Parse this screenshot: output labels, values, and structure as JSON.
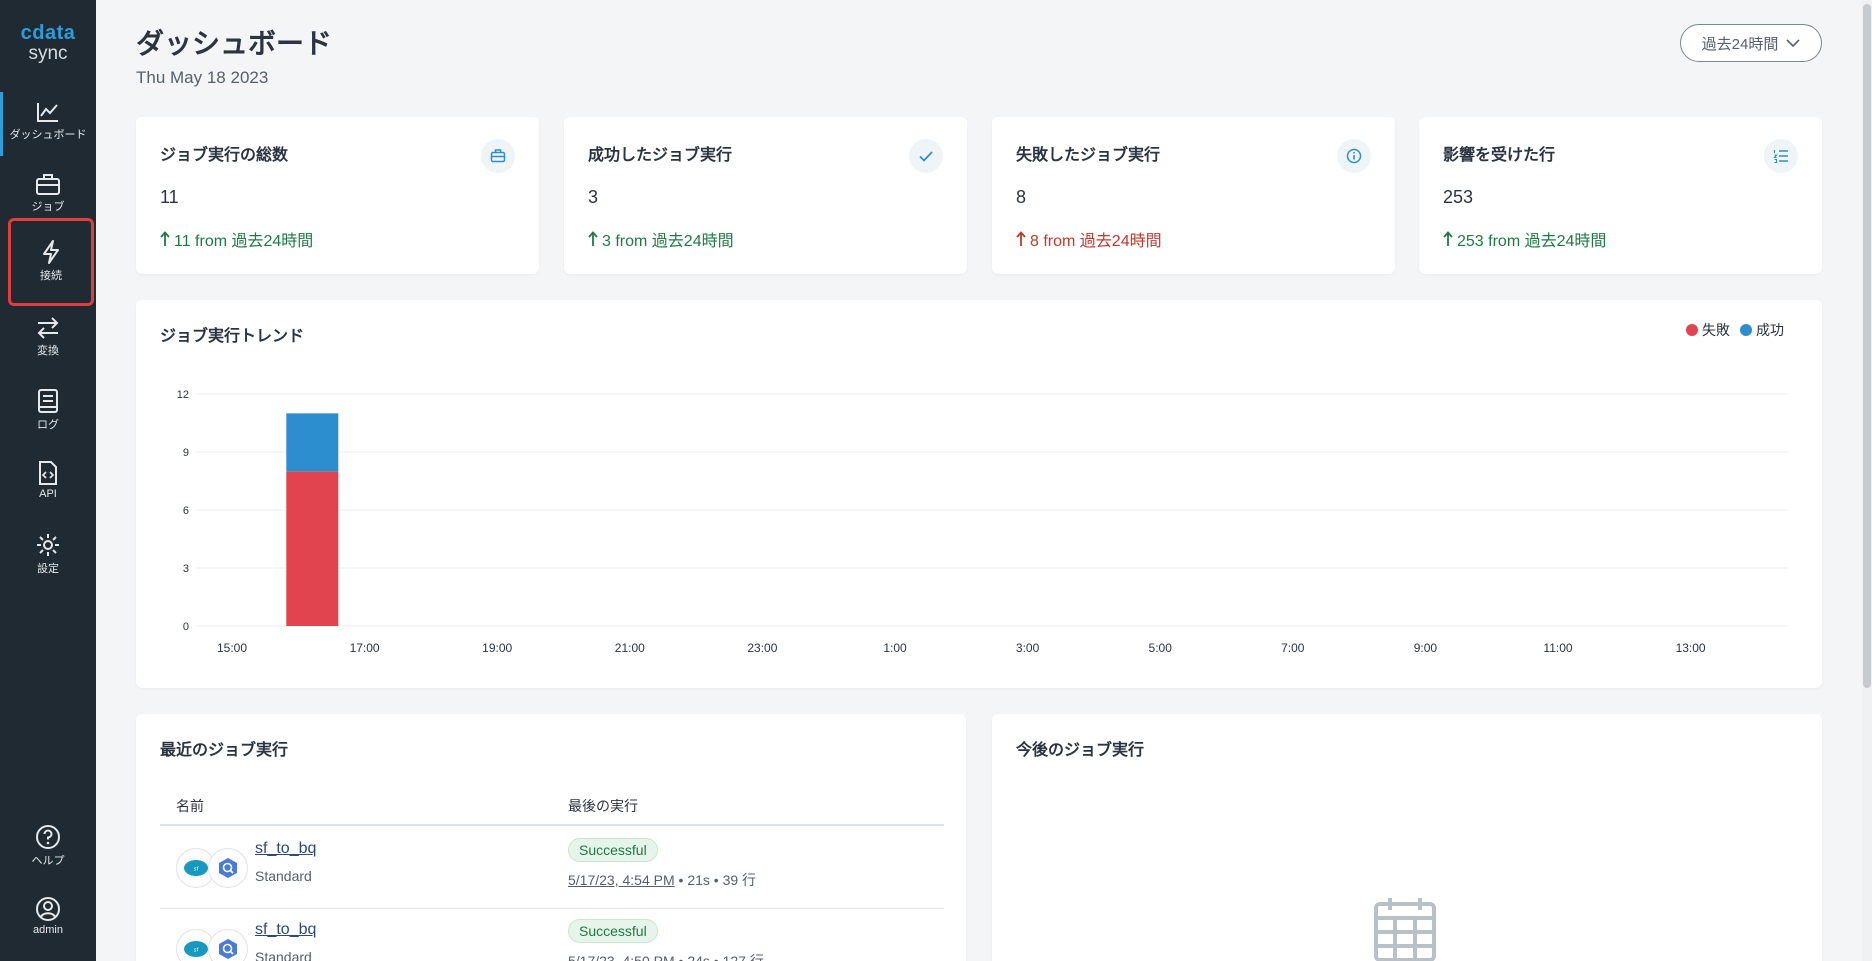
{
  "app": {
    "logo_top": "cdata",
    "logo_bottom": "sync"
  },
  "sidebar": {
    "items": [
      {
        "label": "ダッシュボード",
        "icon": "chart-line-icon"
      },
      {
        "label": "ジョブ",
        "icon": "briefcase-icon"
      },
      {
        "label": "接続",
        "icon": "lightning-icon"
      },
      {
        "label": "変換",
        "icon": "transfer-icon"
      },
      {
        "label": "ログ",
        "icon": "log-book-icon"
      },
      {
        "label": "API",
        "icon": "api-file-icon"
      },
      {
        "label": "設定",
        "icon": "gear-icon"
      }
    ],
    "bottom": [
      {
        "label": "ヘルプ",
        "icon": "help-icon"
      },
      {
        "label": "admin",
        "icon": "user-icon"
      }
    ]
  },
  "header": {
    "title": "ダッシュボード",
    "date": "Thu May 18 2023",
    "range": "過去24時間"
  },
  "stats": [
    {
      "title": "ジョブ実行の総数",
      "value": "11",
      "trend": "11 from 過去24時間",
      "icon": "briefcase-icon",
      "status": "up"
    },
    {
      "title": "成功したジョブ実行",
      "value": "3",
      "trend": "3 from 過去24時間",
      "icon": "check-icon",
      "status": "up"
    },
    {
      "title": "失敗したジョブ実行",
      "value": "8",
      "trend": "8 from 過去24時間",
      "icon": "info-icon",
      "status": "bad"
    },
    {
      "title": "影響を受けた行",
      "value": "253",
      "trend": "253 from 過去24時間",
      "icon": "list-icon",
      "status": "up"
    }
  ],
  "trend": {
    "title": "ジョブ実行トレンド",
    "legend_failed": "失敗",
    "legend_success": "成功"
  },
  "chart_data": {
    "type": "bar",
    "stacked": true,
    "title": "ジョブ実行トレンド",
    "categories": [
      "15:00",
      "16:00",
      "17:00",
      "18:00",
      "19:00",
      "20:00",
      "21:00",
      "22:00",
      "23:00",
      "0:00",
      "1:00",
      "2:00",
      "3:00",
      "4:00",
      "5:00",
      "6:00",
      "7:00",
      "8:00",
      "9:00",
      "10:00",
      "11:00",
      "12:00",
      "13:00",
      "14:00"
    ],
    "tick_labels": [
      "15:00",
      "17:00",
      "19:00",
      "21:00",
      "23:00",
      "1:00",
      "3:00",
      "5:00",
      "7:00",
      "9:00",
      "11:00",
      "13:00"
    ],
    "series": [
      {
        "name": "失敗",
        "color": "#e2444f",
        "values": [
          0,
          8,
          0,
          0,
          0,
          0,
          0,
          0,
          0,
          0,
          0,
          0,
          0,
          0,
          0,
          0,
          0,
          0,
          0,
          0,
          0,
          0,
          0,
          0
        ]
      },
      {
        "name": "成功",
        "color": "#2d8ecf",
        "values": [
          0,
          3,
          0,
          0,
          0,
          0,
          0,
          0,
          0,
          0,
          0,
          0,
          0,
          0,
          0,
          0,
          0,
          0,
          0,
          0,
          0,
          0,
          0,
          0
        ]
      }
    ],
    "ylim": [
      0,
      12
    ],
    "yticks": [
      0,
      3,
      6,
      9,
      12
    ],
    "grid": true,
    "legend": "top-right"
  },
  "recent": {
    "title": "最近のジョブ実行",
    "col_name": "名前",
    "col_last": "最後の実行",
    "rows": [
      {
        "name": "sf_to_bq",
        "type": "Standard",
        "status": "Successful",
        "time": "5/17/23, 4:54 PM",
        "meta": " • 21s • 39 行"
      },
      {
        "name": "sf_to_bq",
        "type": "Standard",
        "status": "Successful",
        "time": "5/17/23, 4:50 PM",
        "meta": " • 24s • 127 行"
      }
    ]
  },
  "upcoming": {
    "title": "今後のジョブ実行"
  }
}
